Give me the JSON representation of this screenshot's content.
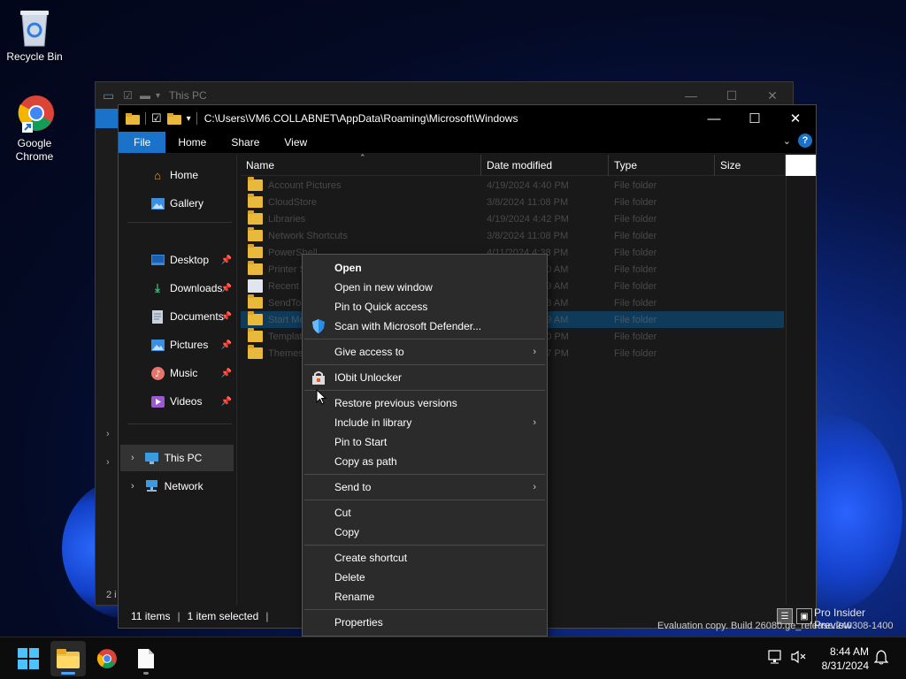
{
  "desktop": {
    "icons": [
      {
        "label": "Recycle Bin"
      },
      {
        "label": "Google Chrome"
      }
    ]
  },
  "back_window": {
    "title": "This PC",
    "nav_count": "2 i"
  },
  "window": {
    "path": "C:\\Users\\VM6.COLLABNET\\AppData\\Roaming\\Microsoft\\Windows",
    "ribbon_tabs": [
      "File",
      "Home",
      "Share",
      "View"
    ],
    "help": "?",
    "nav": [
      {
        "label": "Home",
        "icon": "home-icon"
      },
      {
        "label": "Gallery",
        "icon": "gallery-icon"
      },
      {
        "label": "Desktop",
        "icon": "desktop-icon"
      },
      {
        "label": "Downloads",
        "icon": "downloads-icon"
      },
      {
        "label": "Documents",
        "icon": "documents-icon"
      },
      {
        "label": "Pictures",
        "icon": "pictures-icon"
      },
      {
        "label": "Music",
        "icon": "music-icon"
      },
      {
        "label": "Videos",
        "icon": "videos-icon"
      },
      {
        "label": "This PC",
        "icon": "this-pc-icon"
      },
      {
        "label": "Network",
        "icon": "network-icon"
      }
    ],
    "columns": [
      "Name",
      "Date modified",
      "Type",
      "Size"
    ],
    "files": [
      {
        "name": "Account Pictures",
        "date": "4/19/2024 4:40 PM",
        "type": "File folder"
      },
      {
        "name": "CloudStore",
        "date": "3/8/2024 11:08 PM",
        "type": "File folder"
      },
      {
        "name": "Libraries",
        "date": "4/19/2024 4:42 PM",
        "type": "File folder"
      },
      {
        "name": "Network Shortcuts",
        "date": "3/8/2024 11:08 PM",
        "type": "File folder"
      },
      {
        "name": "PowerShell",
        "date": "4/11/2024 4:38 PM",
        "type": "File folder"
      },
      {
        "name": "Printer Shortcuts",
        "date": "8/31/2024 8:30 AM",
        "type": "File folder"
      },
      {
        "name": "Recent Items",
        "date": "8/31/2024 8:39 AM",
        "type": "File folder"
      },
      {
        "name": "SendTo",
        "date": "8/31/2024 8:28 AM",
        "type": "File folder"
      },
      {
        "name": "Start Menu",
        "date": "8/31/2024 8:29 AM",
        "type": "File folder"
      },
      {
        "name": "Templates",
        "date": "4/19/2024 4:40 PM",
        "type": "File folder"
      },
      {
        "name": "Themes",
        "date": "8/31/2024 8:27 PM",
        "type": "File folder"
      }
    ],
    "status": {
      "items": "11 items",
      "selected": "1 item selected"
    }
  },
  "context_menu": {
    "items": [
      {
        "label": "Open",
        "bold": true
      },
      {
        "label": "Open in new window"
      },
      {
        "label": "Pin to Quick access"
      },
      {
        "label": "Scan with Microsoft Defender..."
      },
      {
        "label": "Give access to"
      },
      {
        "label": "IObit Unlocker"
      },
      {
        "label": "Restore previous versions"
      },
      {
        "label": "Include in library"
      },
      {
        "label": "Pin to Start"
      },
      {
        "label": "Copy as path"
      },
      {
        "label": "Send to"
      },
      {
        "label": "Cut"
      },
      {
        "label": "Copy"
      },
      {
        "label": "Create shortcut"
      },
      {
        "label": "Delete"
      },
      {
        "label": "Rename"
      },
      {
        "label": "Properties"
      }
    ]
  },
  "watermark": {
    "line1": "Pro Insider Preview",
    "line2": "Evaluation copy. Build 26080.ge_release.240308-1400"
  },
  "taskbar": {
    "time": "8:44 AM",
    "date": "8/31/2024"
  },
  "colors": {
    "accent": "#1a73c8",
    "selection": "#103a5a",
    "folder": "#e8b93a"
  }
}
